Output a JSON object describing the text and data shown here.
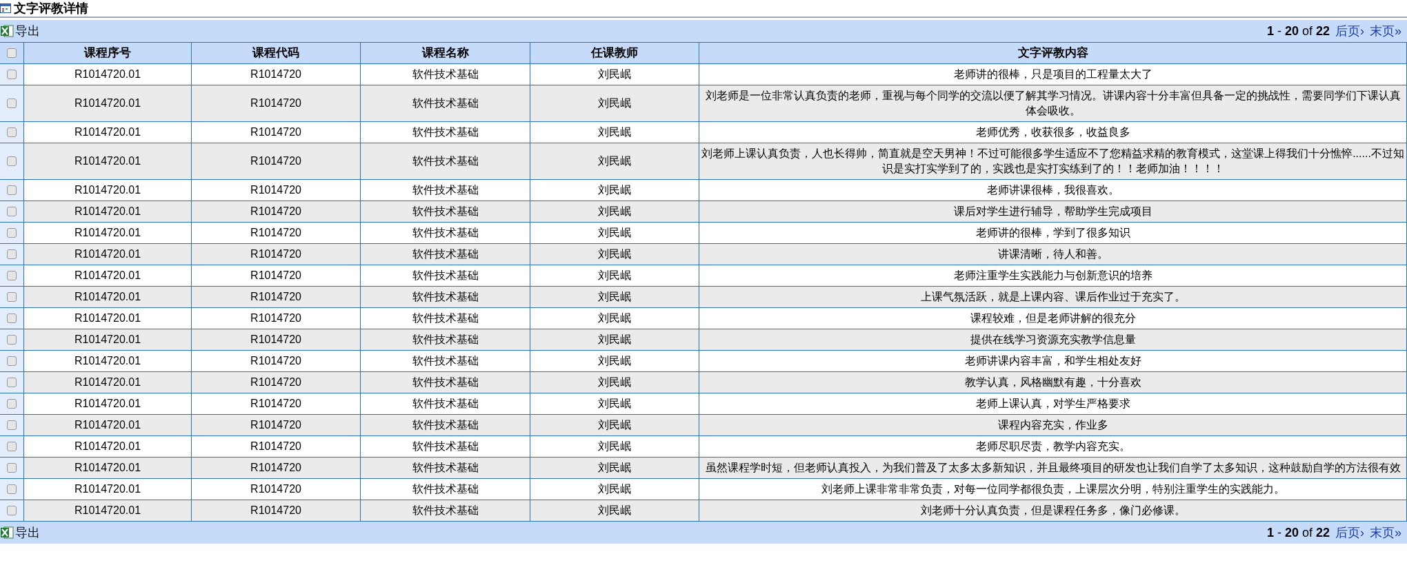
{
  "title": "文字评教详情",
  "toolbar_top": {
    "export": "导出",
    "range": "**1** - **20** of **22**",
    "next": "后页›",
    "last": "末页»"
  },
  "table": {
    "select_all": {
      "checked": false
    },
    "columns": [
      "课程序号",
      "课程代码",
      "课程名称",
      "任课教师",
      "文字评教内容"
    ],
    "rows": [
      {
        "checked": false,
        "cells": [
          "R1014720.01",
          "R1014720",
          "软件技术基础",
          "刘民岷",
          "老师讲的很棒，只是项目的工程量太大了"
        ]
      },
      {
        "checked": false,
        "cells": [
          "R1014720.01",
          "R1014720",
          "软件技术基础",
          "刘民岷",
          "刘老师是一位非常认真负责的老师，重视与每个同学的交流以便了解其学习情况。讲课内容十分丰富但具备一定的挑战性，需要同学们下课认真体会吸收。"
        ]
      },
      {
        "checked": false,
        "cells": [
          "R1014720.01",
          "R1014720",
          "软件技术基础",
          "刘民岷",
          "老师优秀，收获很多，收益良多"
        ]
      },
      {
        "checked": false,
        "cells": [
          "R1014720.01",
          "R1014720",
          "软件技术基础",
          "刘民岷",
          "刘老师上课认真负责，人也长得帅，简直就是空天男神！不过可能很多学生适应不了您精益求精的教育模式，这堂课上得我们十分憔悴......不过知识是实打实学到了的，实践也是实打实练到了的！！老师加油！！！！"
        ]
      },
      {
        "checked": false,
        "cells": [
          "R1014720.01",
          "R1014720",
          "软件技术基础",
          "刘民岷",
          "老师讲课很棒，我很喜欢。"
        ]
      },
      {
        "checked": false,
        "cells": [
          "R1014720.01",
          "R1014720",
          "软件技术基础",
          "刘民岷",
          "课后对学生进行辅导，帮助学生完成项目"
        ]
      },
      {
        "checked": false,
        "cells": [
          "R1014720.01",
          "R1014720",
          "软件技术基础",
          "刘民岷",
          "老师讲的很棒，学到了很多知识"
        ]
      },
      {
        "checked": false,
        "cells": [
          "R1014720.01",
          "R1014720",
          "软件技术基础",
          "刘民岷",
          "讲课清晰，待人和善。"
        ]
      },
      {
        "checked": false,
        "cells": [
          "R1014720.01",
          "R1014720",
          "软件技术基础",
          "刘民岷",
          "老师注重学生实践能力与创新意识的培养"
        ]
      },
      {
        "checked": false,
        "cells": [
          "R1014720.01",
          "R1014720",
          "软件技术基础",
          "刘民岷",
          "上课气氛活跃，就是上课内容、课后作业过于充实了。"
        ]
      },
      {
        "checked": false,
        "cells": [
          "R1014720.01",
          "R1014720",
          "软件技术基础",
          "刘民岷",
          "课程较难，但是老师讲解的很充分"
        ]
      },
      {
        "checked": false,
        "cells": [
          "R1014720.01",
          "R1014720",
          "软件技术基础",
          "刘民岷",
          "提供在线学习资源充实教学信息量"
        ]
      },
      {
        "checked": false,
        "cells": [
          "R1014720.01",
          "R1014720",
          "软件技术基础",
          "刘民岷",
          "老师讲课内容丰富，和学生相处友好"
        ]
      },
      {
        "checked": false,
        "cells": [
          "R1014720.01",
          "R1014720",
          "软件技术基础",
          "刘民岷",
          "教学认真，风格幽默有趣，十分喜欢"
        ]
      },
      {
        "checked": false,
        "cells": [
          "R1014720.01",
          "R1014720",
          "软件技术基础",
          "刘民岷",
          "老师上课认真，对学生严格要求"
        ]
      },
      {
        "checked": false,
        "cells": [
          "R1014720.01",
          "R1014720",
          "软件技术基础",
          "刘民岷",
          "课程内容充实，作业多"
        ]
      },
      {
        "checked": false,
        "cells": [
          "R1014720.01",
          "R1014720",
          "软件技术基础",
          "刘民岷",
          "老师尽职尽责，教学内容充实。"
        ]
      },
      {
        "checked": false,
        "cells": [
          "R1014720.01",
          "R1014720",
          "软件技术基础",
          "刘民岷",
          "虽然课程学时短，但老师认真投入，为我们普及了太多太多新知识，并且最终项目的研发也让我们自学了太多知识，这种鼓励自学的方法很有效"
        ]
      },
      {
        "checked": false,
        "cells": [
          "R1014720.01",
          "R1014720",
          "软件技术基础",
          "刘民岷",
          "刘老师上课非常非常负责，对每一位同学都很负责，上课层次分明，特别注重学生的实践能力。"
        ]
      },
      {
        "checked": false,
        "cells": [
          "R1014720.01",
          "R1014720",
          "软件技术基础",
          "刘民岷",
          "刘老师十分认真负责，但是课程任务多，像门必修课。"
        ]
      }
    ]
  },
  "toolbar_bottom": {
    "export": "导出",
    "range": "**1** - **20** of **22**",
    "next": "后页›",
    "last": "末页»"
  }
}
